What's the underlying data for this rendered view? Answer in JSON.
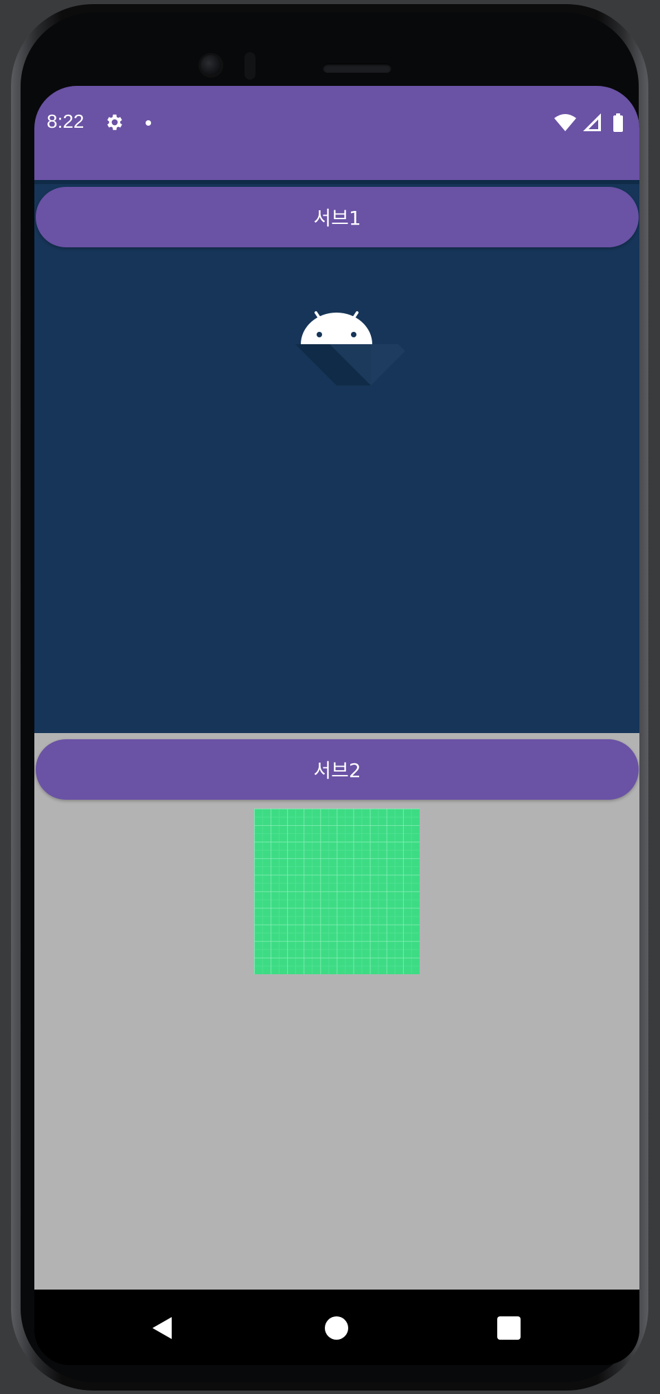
{
  "status_bar": {
    "time": "8:22",
    "background_color": "#6a52a5",
    "icons": [
      "gear-icon",
      "notification-dot-icon",
      "wifi-icon",
      "signal-icon",
      "battery-icon"
    ]
  },
  "sub1": {
    "button_label": "서브1",
    "background_color": "#163558",
    "image_icon": "android-logo-icon"
  },
  "sub2": {
    "button_label": "서브2",
    "background_color": "#b3b3b3",
    "image_icon": "green-grid-image",
    "image_color": "#3ddc84"
  },
  "accent_color": "#6a52a5",
  "nav_bar": {
    "icons": [
      "back-icon",
      "home-icon",
      "recents-icon"
    ]
  }
}
